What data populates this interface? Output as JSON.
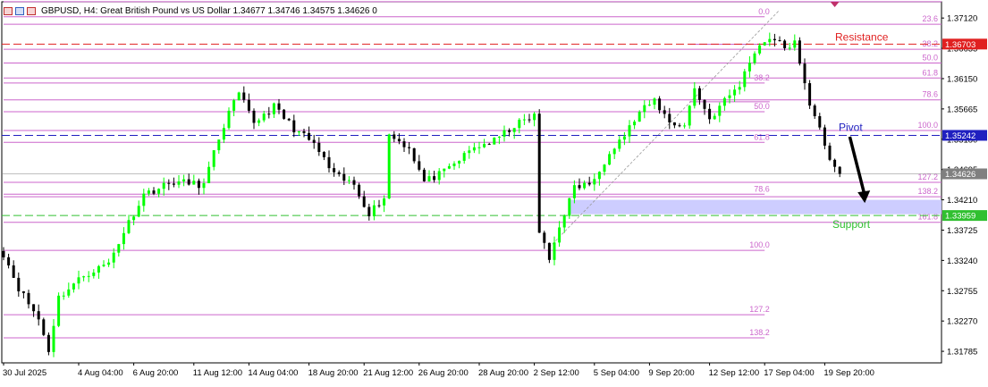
{
  "header": {
    "symbol_line": "GBPUSD, H4:  Great British Pound vs US Dollar  1.34677 1.34746 1.34575 1.34626  0"
  },
  "colors": {
    "bull": "#00ff00",
    "bear": "#000000",
    "fib": "#cc66cc",
    "resistance": "#e02020",
    "pivot": "#2020c0",
    "support": "#30c030",
    "zone": "#c8c8ff",
    "current": "#808080"
  },
  "chart_data": {
    "type": "candlestick",
    "symbol": "GBPUSD",
    "timeframe": "H4",
    "last": {
      "open": 1.34677,
      "high": 1.34746,
      "low": 1.34575,
      "close": 1.34626
    },
    "ylim": [
      1.316,
      1.3738
    ],
    "y_ticks": [
      "1.37120",
      "1.36635",
      "1.36150",
      "1.35665",
      "1.35180",
      "1.34695",
      "1.34210",
      "1.33725",
      "1.33240",
      "1.32755",
      "1.32270",
      "1.31785"
    ],
    "x_ticks": [
      {
        "i": 0,
        "label": "30 Jul 2025"
      },
      {
        "i": 15,
        "label": "4 Aug 04:00"
      },
      {
        "i": 26,
        "label": "6 Aug 20:00"
      },
      {
        "i": 38,
        "label": "11 Aug 12:00"
      },
      {
        "i": 49,
        "label": "14 Aug 04:00"
      },
      {
        "i": 61,
        "label": "18 Aug 20:00"
      },
      {
        "i": 72,
        "label": "21 Aug 12:00"
      },
      {
        "i": 83,
        "label": "26 Aug 20:00"
      },
      {
        "i": 95,
        "label": "28 Aug 20:00"
      },
      {
        "i": 106,
        "label": "2 Sep 12:00"
      },
      {
        "i": 118,
        "label": "5 Sep 04:00"
      },
      {
        "i": 129,
        "label": "9 Sep 20:00"
      },
      {
        "i": 141,
        "label": "12 Sep 12:00"
      },
      {
        "i": 152,
        "label": "17 Sep 04:00"
      },
      {
        "i": 164,
        "label": "19 Sep 20:00"
      }
    ],
    "close_path": [
      [
        0,
        1.3335
      ],
      [
        3,
        1.328
      ],
      [
        7,
        1.323
      ],
      [
        9,
        1.318
      ],
      [
        11,
        1.3265
      ],
      [
        16,
        1.33
      ],
      [
        21,
        1.332
      ],
      [
        24,
        1.337
      ],
      [
        28,
        1.343
      ],
      [
        34,
        1.345
      ],
      [
        40,
        1.3445
      ],
      [
        43,
        1.352
      ],
      [
        45,
        1.356
      ],
      [
        47,
        1.359
      ],
      [
        50,
        1.3545
      ],
      [
        54,
        1.357
      ],
      [
        58,
        1.3535
      ],
      [
        62,
        1.351
      ],
      [
        66,
        1.346
      ],
      [
        70,
        1.3445
      ],
      [
        73,
        1.34
      ],
      [
        76,
        1.3425
      ],
      [
        77,
        1.3525
      ],
      [
        81,
        1.3505
      ],
      [
        84,
        1.345
      ],
      [
        88,
        1.3465
      ],
      [
        91,
        1.3485
      ],
      [
        94,
        1.3505
      ],
      [
        98,
        1.3515
      ],
      [
        102,
        1.354
      ],
      [
        106,
        1.3555
      ],
      [
        107,
        1.337
      ],
      [
        109,
        1.3325
      ],
      [
        111,
        1.338
      ],
      [
        114,
        1.344
      ],
      [
        118,
        1.345
      ],
      [
        121,
        1.35
      ],
      [
        124,
        1.3525
      ],
      [
        127,
        1.356
      ],
      [
        130,
        1.358
      ],
      [
        133,
        1.3545
      ],
      [
        136,
        1.354
      ],
      [
        138,
        1.36
      ],
      [
        141,
        1.355
      ],
      [
        144,
        1.358
      ],
      [
        147,
        1.3605
      ],
      [
        150,
        1.366
      ],
      [
        153,
        1.3682
      ],
      [
        156,
        1.3665
      ],
      [
        158,
        1.3672
      ],
      [
        159,
        1.3635
      ],
      [
        161,
        1.3575
      ],
      [
        163,
        1.354
      ],
      [
        165,
        1.348
      ],
      [
        167,
        1.3463
      ]
    ],
    "fib_a": {
      "x_range": [
        0,
        193
      ],
      "level_prices": [
        1.37382,
        1.3702,
        1.3662,
        1.364,
        1.3616,
        1.3581,
        1.3532
      ],
      "level_labels": [
        "0.0",
        "23.6",
        "38.2",
        "50.0",
        "61.8",
        "78.6",
        "100.0"
      ]
    },
    "fib_b": {
      "x_range": [
        0,
        193
      ],
      "level_prices": [
        1.3449,
        1.3426,
        1.3385
      ],
      "level_labels": [
        "127.2",
        "138.2",
        "161.8"
      ]
    },
    "fib_c": {
      "x_range": [
        0,
        152
      ],
      "level_prices": [
        1.3714,
        1.3608,
        1.3562,
        1.3513,
        1.343,
        1.334,
        1.3237,
        1.32
      ],
      "level_labels": [
        "0.0",
        "38.2",
        "50.0",
        "61.8",
        "78.6",
        "100.0",
        "127.2",
        "138.2"
      ]
    },
    "fib_c_label_idx": 153,
    "fib_inner": {
      "x_start": 137,
      "level_prices": [
        1.367,
        1.3578
      ],
      "level_labels": [
        "",
        ""
      ]
    },
    "trend_line": {
      "from": [
        109,
        1.3345
      ],
      "to": [
        155,
        1.3725
      ]
    },
    "lines": {
      "resistance": {
        "price": 1.36703,
        "label": "Resistance",
        "tag": "1.36703"
      },
      "pivot": {
        "price": 1.35242,
        "label": "Pivot",
        "tag": "1.35242"
      },
      "support": {
        "price": 1.33959,
        "label": "Support",
        "tag": "1.33959"
      }
    },
    "current_price": {
      "price": 1.34626,
      "tag": "1.34626"
    },
    "zone": {
      "i_from": 113,
      "i_to": 193,
      "price_top": 1.3421,
      "price_bottom": 1.3398
    },
    "arrow": {
      "from": [
        169,
        1.3522
      ],
      "to": [
        172,
        1.3416
      ]
    },
    "top_marker_index": 166
  }
}
